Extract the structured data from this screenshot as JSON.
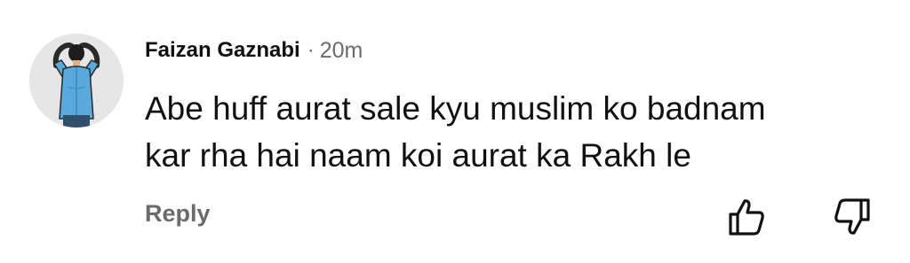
{
  "comment": {
    "author": "Faizan Gaznabi",
    "separator": "·",
    "time": "20m",
    "lines": [
      "Abe huff aurat sale kyu muslim ko badnam",
      "kar rha hai naam koi aurat ka Rakh le"
    ],
    "reply_label": "Reply",
    "avatar_icon": "person-hands-behind-head",
    "upvote_icon": "thumbs-up-icon",
    "downvote_icon": "thumbs-down-icon"
  },
  "colors": {
    "text": "#111111",
    "muted": "#6b6b6b",
    "avatar_bg": "#e6e6e6",
    "shirt": "#5aa9dc"
  }
}
